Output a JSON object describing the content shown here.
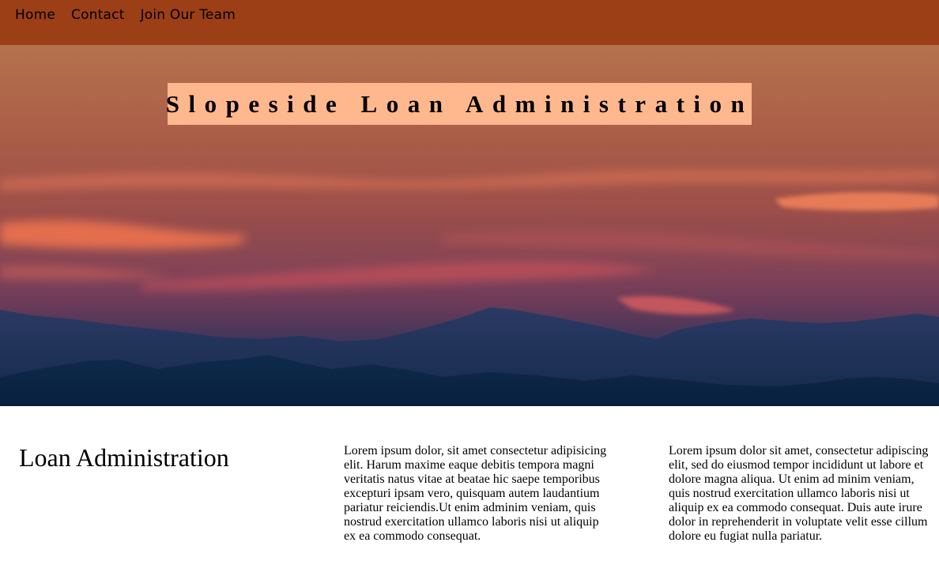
{
  "nav": {
    "items": [
      {
        "label": "Home"
      },
      {
        "label": "Contact"
      },
      {
        "label": "Join Our Team"
      }
    ]
  },
  "hero": {
    "title": "Slopeside Loan Administration",
    "image": "sunset-over-mountains"
  },
  "content": {
    "heading": "Loan Administration",
    "column1": "Lorem ipsum dolor, sit amet consectetur adipisicing elit. Harum maxime eaque debitis tempora magni veritatis natus vitae at beatae hic saepe temporibus excepturi ipsam vero, quisquam autem laudantium pariatur reiciendis.Ut enim adminim veniam, quis nostrud exercitation ullamco laboris nisi ut aliquip ex ea commodo consequat.",
    "column2": "Lorem ipsum dolor sit amet, consectetur adipiscing elit, sed do eiusmod tempor incididunt ut labore et dolore magna aliqua. Ut enim ad minim veniam, quis nostrud exercitation ullamco laboris nisi ut aliquip ex ea commodo consequat. Duis aute irure dolor in reprehenderit in voluptate velit esse cillum dolore eu fugiat nulla pariatur."
  },
  "colors": {
    "nav_background": "#9c3f16",
    "title_box_background": "#ffb88e",
    "mountain_dark": "#0d2445",
    "cloud_glow": "#ff7a4e"
  }
}
